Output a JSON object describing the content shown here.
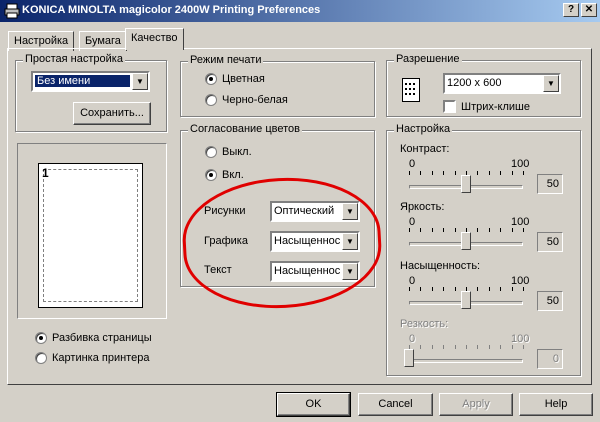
{
  "window": {
    "title": "KONICA MINOLTA magicolor 2400W Printing Preferences",
    "help_button": "?",
    "close_button": "X"
  },
  "tabs": [
    {
      "label": "Настройка"
    },
    {
      "label": "Бумага"
    },
    {
      "label": "Качество"
    }
  ],
  "left": {
    "preset_group": "Простая настройка",
    "preset_value": "Без имени",
    "save_button": "Сохранить...",
    "page_number": "1",
    "radio_page_split": "Разбивка страницы",
    "radio_printer_picture": "Картинка принтера",
    "selected_view": "Разбивка страницы"
  },
  "print_mode": {
    "title": "Режим печати",
    "color": "Цветная",
    "bw": "Черно-белая",
    "selected": "Цветная"
  },
  "color_matching": {
    "title": "Согласование цветов",
    "off": "Выкл.",
    "on": "Вкл.",
    "selected": "Вкл.",
    "pictures_label": "Рисунки",
    "pictures_value": "Оптический",
    "graphics_label": "Графика",
    "graphics_value": "Насыщенност",
    "text_label": "Текст",
    "text_value": "Насыщенност"
  },
  "resolution": {
    "title": "Разрешение",
    "value": "1200 x 600",
    "halftone_label": "Штрих-клише",
    "halftone_checked": false
  },
  "settings": {
    "title": "Настройка",
    "contrast": {
      "label": "Контраст:",
      "min": "0",
      "max": "100",
      "value": "50",
      "level": 0.5
    },
    "brightness": {
      "label": "Яркость:",
      "min": "0",
      "max": "100",
      "value": "50",
      "level": 0.5
    },
    "saturation": {
      "label": "Насыщенность:",
      "min": "0",
      "max": "100",
      "value": "50",
      "level": 0.5
    },
    "sharpness": {
      "label": "Резкость:",
      "min": "0",
      "max": "100",
      "value": "0",
      "level": 0,
      "disabled": true
    }
  },
  "footer": {
    "ok": "OK",
    "cancel": "Cancel",
    "apply": "Apply",
    "help": "Help"
  },
  "colors": {
    "title_bar_start": "#0a246a",
    "title_bar_end": "#a6caf0",
    "annotation_red": "#e00000"
  }
}
